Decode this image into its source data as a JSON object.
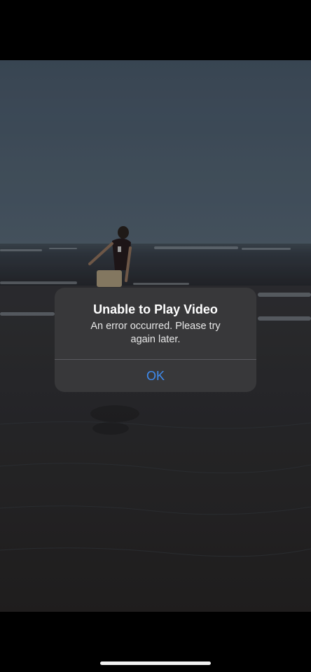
{
  "alert": {
    "title": "Unable to Play Video",
    "message": "An error occurred. Please try again later.",
    "ok_label": "OK"
  },
  "colors": {
    "alert_background": "#3a3a3c",
    "button_text": "#3f8cf0",
    "home_indicator": "#f2f2f2"
  }
}
